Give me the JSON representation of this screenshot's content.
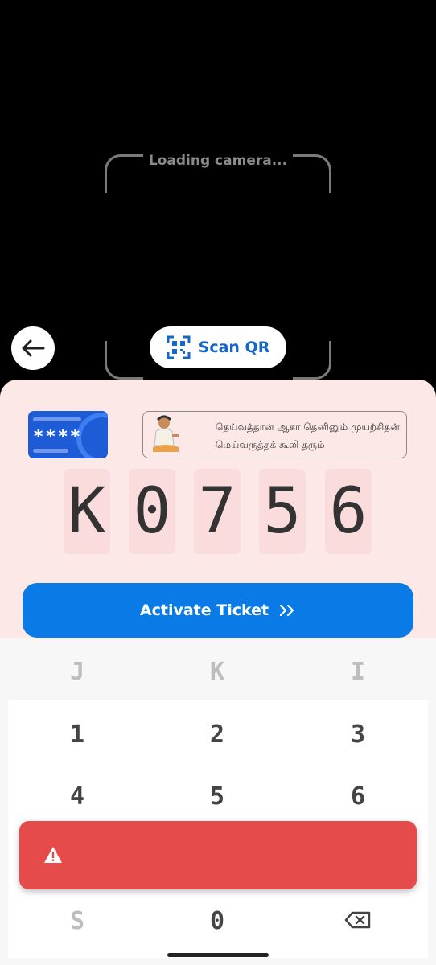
{
  "camera": {
    "loading_text": "Loading camera...",
    "scan_label": "Scan QR"
  },
  "card": {
    "masked_number": "****"
  },
  "quote": {
    "line1": "தெய்வத்தான் ஆகா தெனினும் முயற்சிதன்",
    "line2": "மெய்வருத்தக் கூலி தரும்"
  },
  "code": {
    "digits": [
      "K",
      "0",
      "7",
      "5",
      "6"
    ]
  },
  "activate": {
    "label": "Activate Ticket",
    "chevron": "»"
  },
  "keypad": {
    "row0": [
      "J",
      "K",
      "I"
    ],
    "row1": [
      "1",
      "2",
      "3"
    ],
    "row2": [
      "4",
      "5",
      "6"
    ],
    "row4": [
      "S",
      "0"
    ]
  },
  "colors": {
    "accent": "#0a7be6",
    "scan_blue": "#1467c8",
    "sheet_bg": "#fde8e8",
    "error": "#e64b4b"
  },
  "icons": [
    "back-arrow-icon",
    "qr-scan-icon",
    "card-icon",
    "double-chevron-right-icon",
    "backspace-icon",
    "warning-icon"
  ]
}
